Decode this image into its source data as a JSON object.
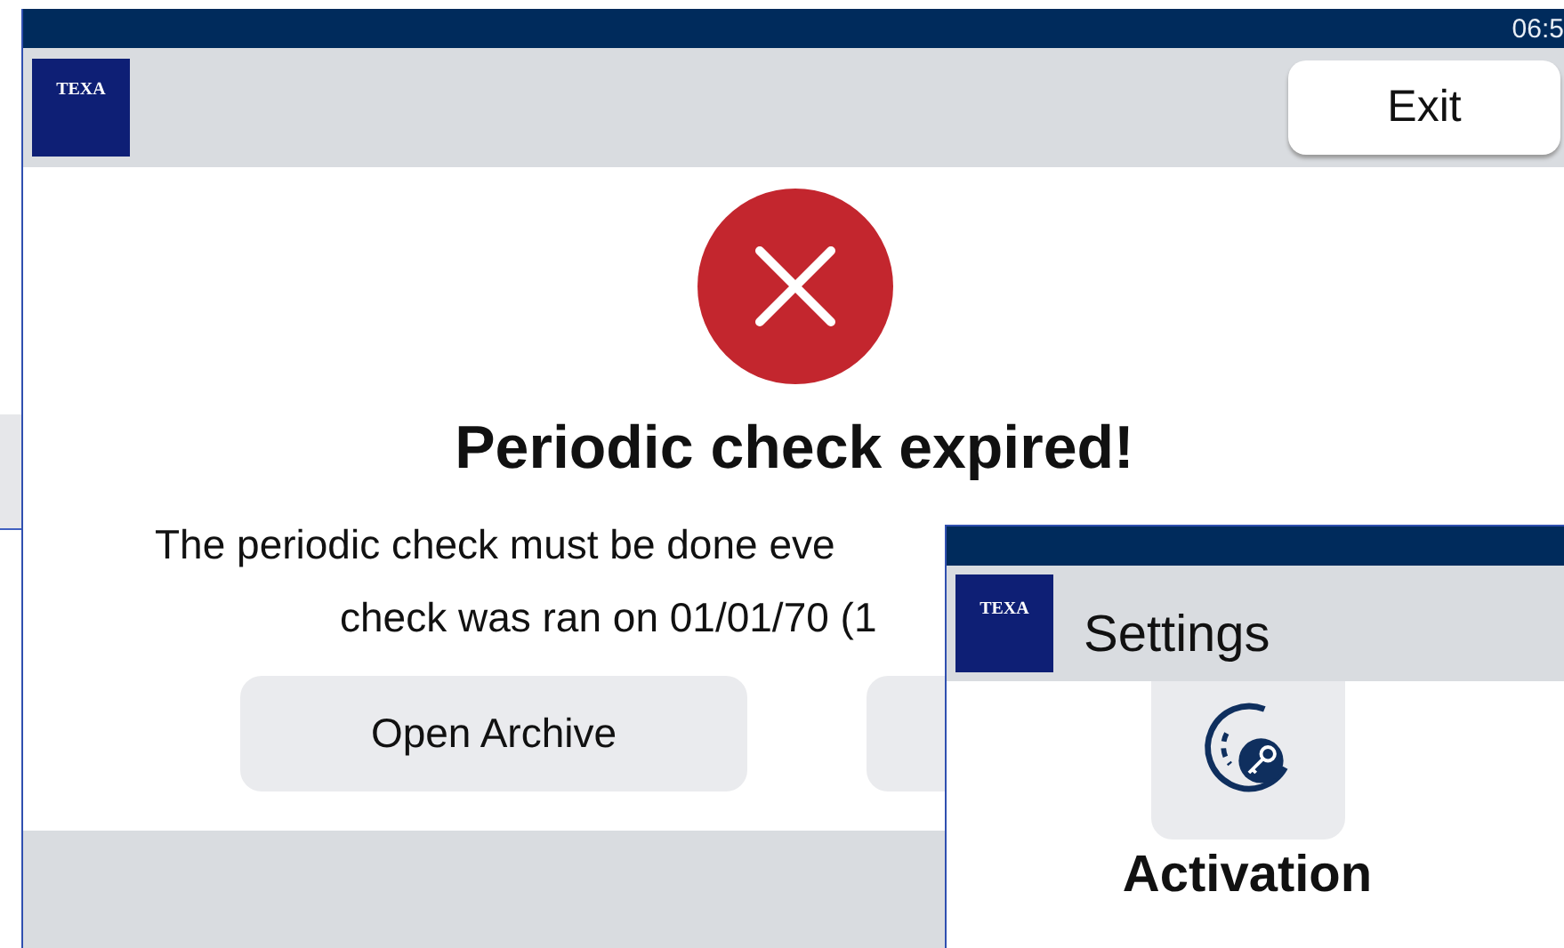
{
  "main_window": {
    "clock": "06:5",
    "logo": "TEXA",
    "exit_button": "Exit",
    "alert": {
      "title": "Periodic check expired!",
      "message_lines": [
        "The periodic check must be done eve",
        "check was ran on 01/01/70 (1"
      ],
      "buttons": [
        "Open Archive"
      ]
    }
  },
  "settings_window": {
    "logo": "TEXA",
    "title": "Settings",
    "tiles": [
      {
        "label": "Activation"
      }
    ]
  }
}
